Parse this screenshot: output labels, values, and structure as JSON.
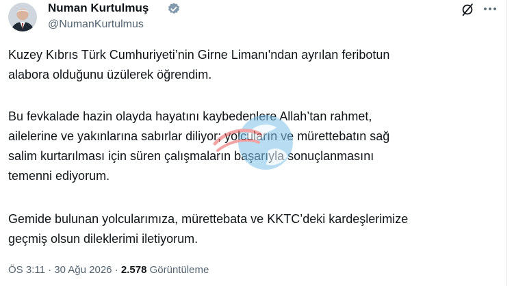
{
  "author": {
    "name": "Numan Kurtulmuş",
    "handle": "@NumanKurtulmus",
    "verified_icon": "verified-badge-icon"
  },
  "actions": {
    "grok_icon": "grok-slash-icon",
    "more_icon": "more-dots-icon"
  },
  "tweet": {
    "paragraph1": "Kuzey Kıbrıs Türk Cumhuriyeti’nin Girne Limanı'ndan ayrılan feribotun\nalabora olduğunu üzülerek öğrendim.",
    "paragraph2": "Bu fevkalade hazin olayda hayatını kaybedenlere Allah’tan rahmet,\nailelerine ve yakınlarına sabırlar diliyor; yolcuların ve mürettebatın sağ\nsalim kurtarılması için süren çalışmaların başarıyla sonuçlanmasını\ntemenni ediyorum.",
    "paragraph3": "Gemide bulunan yolcularımıza, mürettebata ve KKTC’deki kardeşlerimize\ngeçmiş olsun dileklerimi iletiyorum."
  },
  "footer": {
    "time": "ÖS 3:11",
    "separator": "·",
    "date": "30 Ağu 2026",
    "views_count": "2.578",
    "views_label": "Görüntüleme"
  },
  "colors": {
    "text": "#0f1419",
    "secondary": "#536471",
    "verified": "#829aab"
  }
}
